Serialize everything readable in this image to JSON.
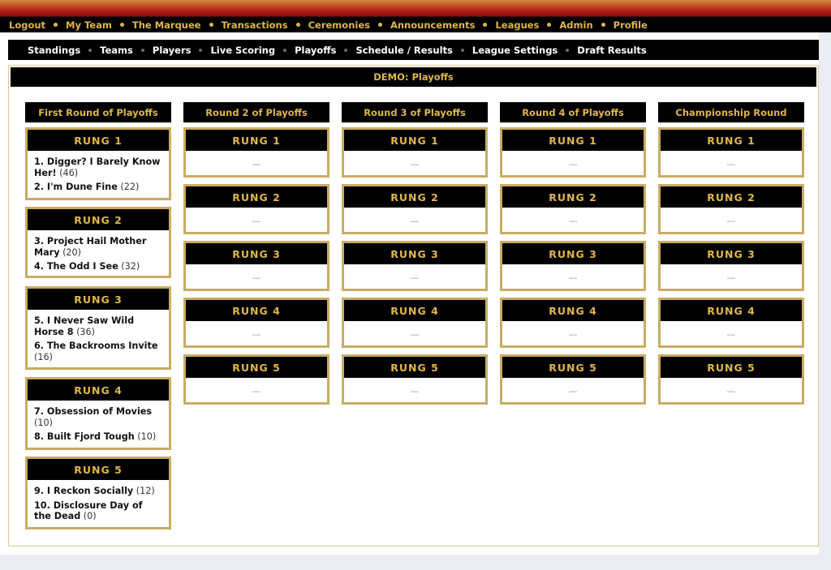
{
  "top_nav": [
    "Logout",
    "My Team",
    "The Marquee",
    "Transactions",
    "Ceremonies",
    "Announcements",
    "Leagues",
    "Admin",
    "Profile"
  ],
  "sub_nav": [
    "Standings",
    "Teams",
    "Players",
    "Live Scoring",
    "Playoffs",
    "Schedule / Results",
    "League Settings",
    "Draft Results"
  ],
  "panel_title": "DEMO: Playoffs",
  "rounds": [
    {
      "title": "First Round of Playoffs"
    },
    {
      "title": "Round 2 of Playoffs"
    },
    {
      "title": "Round 3 of Playoffs"
    },
    {
      "title": "Round 4 of Playoffs"
    },
    {
      "title": "Championship Round"
    }
  ],
  "rung_labels": [
    "RUNG 1",
    "RUNG 2",
    "RUNG 3",
    "RUNG 4",
    "RUNG 5"
  ],
  "empty_placeholder": "—",
  "first_round_matchups": [
    {
      "teams": [
        {
          "name": "1. Digger? I Barely Know Her!",
          "score": "(46)"
        },
        {
          "name": "2. I'm Dune Fine",
          "score": "(22)"
        }
      ]
    },
    {
      "teams": [
        {
          "name": "3. Project Hail Mother Mary",
          "score": "(20)"
        },
        {
          "name": "4. The Odd I See",
          "score": "(32)"
        }
      ]
    },
    {
      "teams": [
        {
          "name": "5. I Never Saw Wild Horse 8",
          "score": "(36)"
        },
        {
          "name": "6. The Backrooms Invite",
          "score": "(16)"
        }
      ]
    },
    {
      "teams": [
        {
          "name": "7. Obsession of Movies",
          "score": "(10)"
        },
        {
          "name": "8. Built Fjord Tough",
          "score": "(10)"
        }
      ]
    },
    {
      "teams": [
        {
          "name": "9. I Reckon Socially",
          "score": "(12)"
        },
        {
          "name": "10. Disclosure Day of the Dead",
          "score": "(0)"
        }
      ]
    }
  ]
}
